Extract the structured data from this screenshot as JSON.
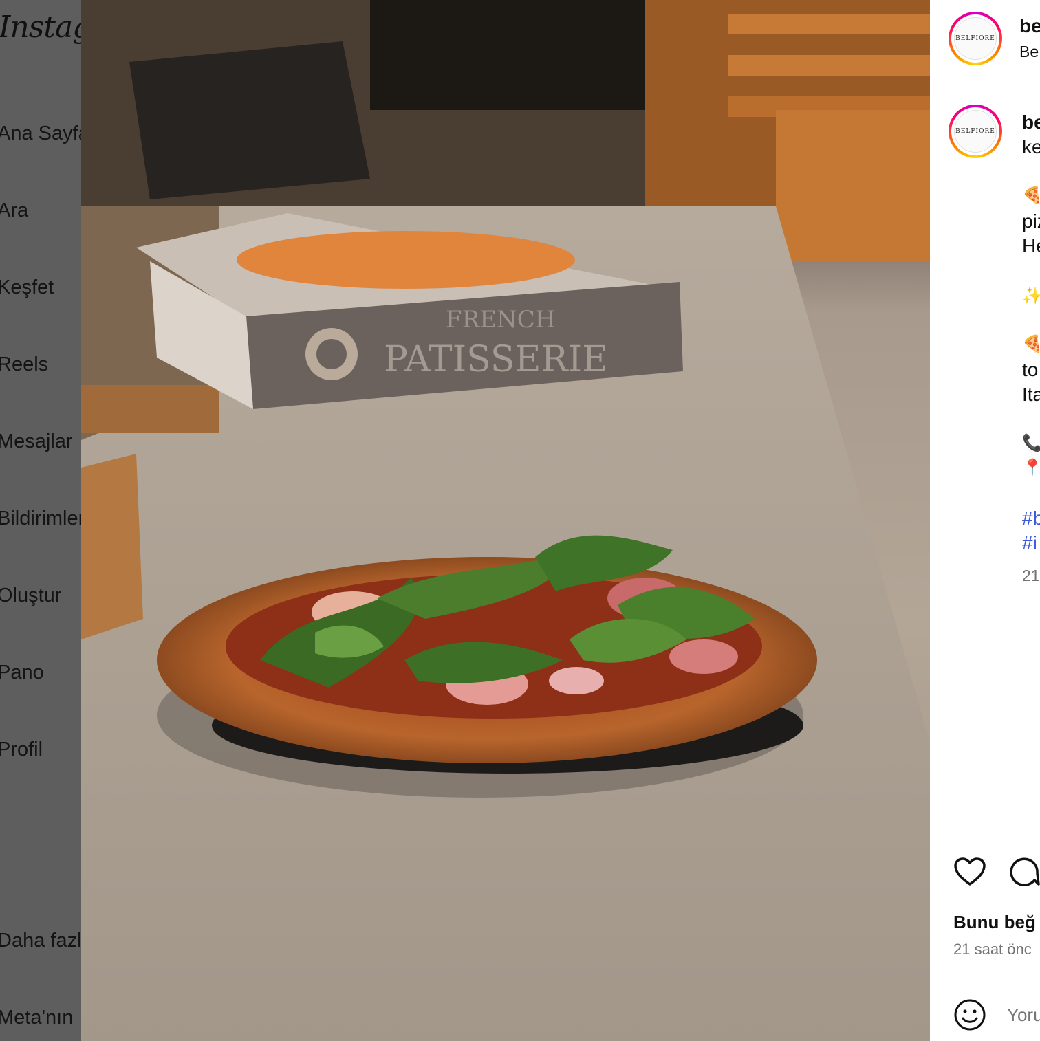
{
  "sidebar": {
    "logo": "Instagram",
    "items": [
      {
        "label": "Ana Sayfa"
      },
      {
        "label": "Ara"
      },
      {
        "label": "Keşfet"
      },
      {
        "label": "Reels"
      },
      {
        "label": "Mesajlar"
      },
      {
        "label": "Bildirimler"
      },
      {
        "label": "Oluştur"
      },
      {
        "label": "Pano"
      },
      {
        "label": "Profil"
      },
      {
        "label": "Daha fazla"
      },
      {
        "label": "Meta'nın"
      }
    ]
  },
  "photo": {
    "box_line1": "FRENCH",
    "box_line2": "PATISSERIE"
  },
  "post": {
    "header": {
      "username": "be",
      "subtitle": "Be",
      "avatar_text": "BELFIORE"
    },
    "caption": {
      "username": "be",
      "line2": "ke",
      "lines": [
        {
          "text": "🍕"
        },
        {
          "text": "piz"
        },
        {
          "text": "He"
        },
        {
          "text": "✨"
        },
        {
          "text": "🍕"
        },
        {
          "text": "to"
        },
        {
          "text": "Ita"
        },
        {
          "text": "📞"
        },
        {
          "text": "📍"
        }
      ],
      "hashtags": [
        "#b",
        "#i"
      ],
      "time": "21"
    },
    "actions": {
      "like_icon": "heart-icon",
      "comment_icon": "comment-icon"
    },
    "likes_text": "Bunu beğ",
    "time_text": "21 saat önc",
    "comment": {
      "emoji_icon": "smiley-icon",
      "placeholder": "Yoru"
    }
  }
}
